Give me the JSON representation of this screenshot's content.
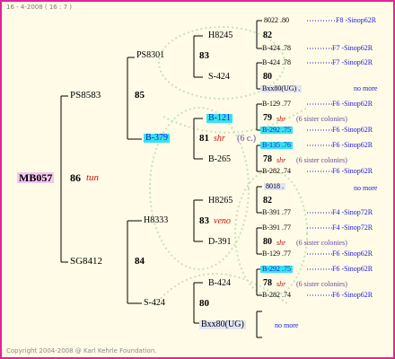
{
  "header": "16 - 4-2008 ( 16 : 7 )",
  "footer": "Copyright 2004-2008 @ Karl Kehrle Foundation.",
  "root": {
    "name": "MB057",
    "score": "86",
    "note": "tun"
  },
  "gen1": {
    "upper": {
      "name": "PS8583",
      "score": "85"
    },
    "lower": {
      "name": "SG8412",
      "score": "84"
    }
  },
  "gen2": {
    "ps8301": {
      "name": "PS8301",
      "score": "83"
    },
    "b379": {
      "name": "B-379",
      "score": "81",
      "note": "shr",
      "extra": "(6 c.)"
    },
    "h8333": {
      "name": "H8333",
      "score": "83",
      "note": "veno"
    },
    "s424": {
      "name": "S-424",
      "score": "80"
    }
  },
  "gen3": {
    "h8245": {
      "name": "H8245",
      "score": "82"
    },
    "s424a": {
      "name": "S-424",
      "score": "80"
    },
    "b121": {
      "name": "B-121",
      "score": "79",
      "note": "shr",
      "extra": "(6 sister colonies)"
    },
    "b265": {
      "name": "B-265",
      "score": "78",
      "note": "shr",
      "extra": "(6 sister colonies)"
    },
    "h8265": {
      "name": "H8265",
      "score": "82"
    },
    "d391": {
      "name": "D-391",
      "score": "80",
      "note": "shr",
      "extra": "(6 sister colonies)"
    },
    "b424": {
      "name": "B-424",
      "score": "78",
      "note": "shr",
      "extra": "(6 sister colonies)"
    },
    "bxx80": {
      "name": "Bxx80(UG)",
      "more": "no more"
    }
  },
  "gen4": [
    {
      "name": "8022 .80",
      "line": "F8 -Sinop62R"
    },
    {
      "name": "B-424 .78",
      "line": "F7 -Sinop62R"
    },
    {
      "name": "B-424 .78",
      "line": "F7 -Sinop62R"
    },
    {
      "name": "Bxx80(UG) .",
      "line": "no more"
    },
    {
      "name": "B-129 .77",
      "line": "F6 -Sinop62R"
    },
    {
      "name": "B-292 .75",
      "line": "F6 -Sinop62R"
    },
    {
      "name": "B-135 .76",
      "line": "F6 -Sinop62R"
    },
    {
      "name": "B-282 .74",
      "line": "F6 -Sinop62R"
    },
    {
      "name": "8018 .",
      "line": "no more"
    },
    {
      "name": "B-391 .77",
      "line": "F4 -Sinop72R"
    },
    {
      "name": "B-391 .77",
      "line": "F4 -Sinop72R"
    },
    {
      "name": "B-129 .77",
      "line": "F6 -Sinop62R"
    },
    {
      "name": "B-292 .75",
      "line": "F6 -Sinop62R"
    },
    {
      "name": "B-282 .74",
      "line": "F6 -Sinop62R"
    }
  ],
  "colors": {
    "frame": "#e0249a",
    "highlight": "#37e3ee",
    "root_bg": "#f4c7f2",
    "line_blue": "#1a1adc"
  }
}
